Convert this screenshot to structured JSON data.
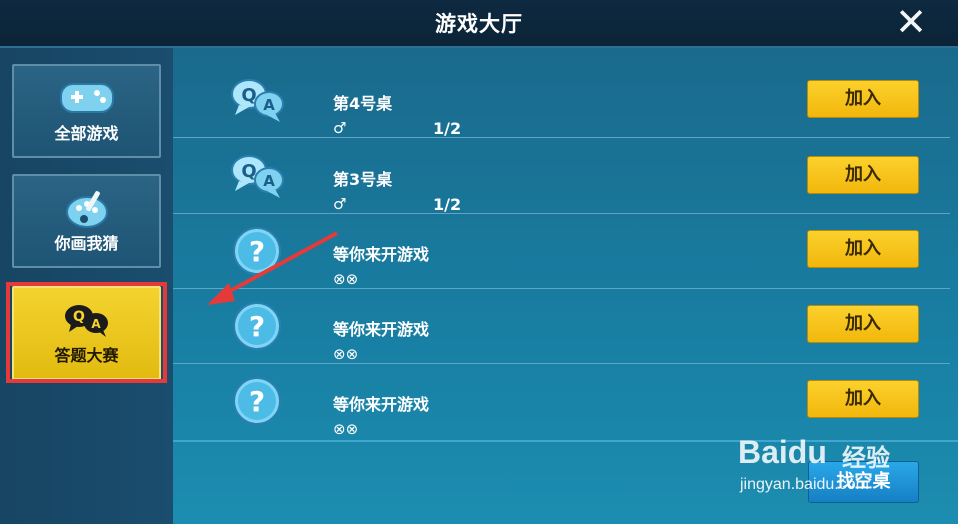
{
  "header": {
    "title": "游戏大厅",
    "close_icon": "close-icon"
  },
  "sidebar": {
    "items": [
      {
        "label": "全部游戏",
        "icon": "gamepad-icon",
        "active": false
      },
      {
        "label": "你画我猜",
        "icon": "palette-icon",
        "active": false
      },
      {
        "label": "答题大赛",
        "icon": "qa-icon",
        "active": true
      }
    ]
  },
  "rooms": [
    {
      "title": "第4号桌",
      "gender": "♂",
      "count": "1/2",
      "icon": "qa-icon",
      "join_label": "加入"
    },
    {
      "title": "第3号桌",
      "gender": "♂",
      "count": "1/2",
      "icon": "qa-icon",
      "join_label": "加入"
    },
    {
      "title": "等你来开游戏",
      "slots": "⊗⊗",
      "icon": "question-icon",
      "join_label": "加入"
    },
    {
      "title": "等你来开游戏",
      "slots": "⊗⊗",
      "icon": "question-icon",
      "join_label": "加入"
    },
    {
      "title": "等你来开游戏",
      "slots": "⊗⊗",
      "icon": "question-icon",
      "join_label": "加入"
    }
  ],
  "footer": {
    "find_empty_label": "找空桌"
  },
  "watermark": {
    "brand": "Baidu",
    "brand_cn": "经验",
    "url": "jingyan.baidu.com"
  },
  "colors": {
    "accent_yellow": "#f4c21b",
    "highlight_red": "#e53a3a",
    "blue_button": "#1f90d6"
  }
}
